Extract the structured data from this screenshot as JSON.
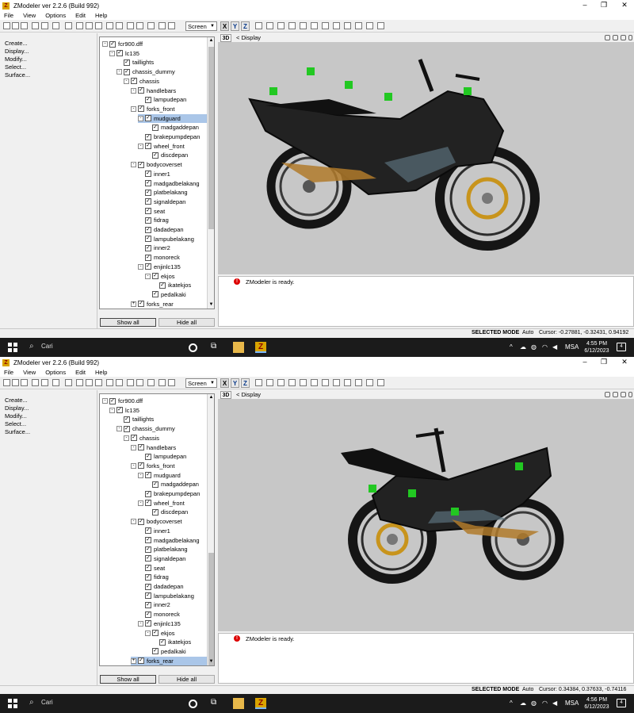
{
  "shots": [
    {
      "window_title": "ZModeler ver 2.2.6 (Build 992)",
      "menu": [
        "File",
        "View",
        "Options",
        "Edit",
        "Help"
      ],
      "toolbar": {
        "screen_label": "Screen",
        "axis_x": "X",
        "axis_y": "Y",
        "axis_z": "Z"
      },
      "left_menu": [
        "Create...",
        "Display...",
        "Modify...",
        "Select...",
        "Surface..."
      ],
      "tree": [
        {
          "label": "fcr900.dff",
          "level": 0,
          "exp": "-",
          "selected": false
        },
        {
          "label": "lc135",
          "level": 1,
          "exp": "-",
          "selected": false
        },
        {
          "label": "taillights",
          "level": 2,
          "exp": "",
          "selected": false
        },
        {
          "label": "chassis_dummy",
          "level": 2,
          "exp": "-",
          "selected": false
        },
        {
          "label": "chassis",
          "level": 3,
          "exp": "-",
          "selected": false
        },
        {
          "label": "handlebars",
          "level": 4,
          "exp": "-",
          "selected": false
        },
        {
          "label": "lampudepan",
          "level": 5,
          "exp": "",
          "selected": false
        },
        {
          "label": "forks_front",
          "level": 4,
          "exp": "-",
          "selected": false
        },
        {
          "label": "mudguard",
          "level": 5,
          "exp": "-",
          "selected": true
        },
        {
          "label": "madgaddepan",
          "level": 6,
          "exp": "",
          "selected": false
        },
        {
          "label": "brakepumpdepan",
          "level": 5,
          "exp": "",
          "selected": false
        },
        {
          "label": "wheel_front",
          "level": 5,
          "exp": "-",
          "selected": false
        },
        {
          "label": "discdepan",
          "level": 6,
          "exp": "",
          "selected": false
        },
        {
          "label": "bodycoverset",
          "level": 4,
          "exp": "-",
          "selected": false
        },
        {
          "label": "inner1",
          "level": 5,
          "exp": "",
          "selected": false
        },
        {
          "label": "madgadbelakang",
          "level": 5,
          "exp": "",
          "selected": false
        },
        {
          "label": "platbelakang",
          "level": 5,
          "exp": "",
          "selected": false
        },
        {
          "label": "signaldepan",
          "level": 5,
          "exp": "",
          "selected": false
        },
        {
          "label": "seat",
          "level": 5,
          "exp": "",
          "selected": false
        },
        {
          "label": "fidrag",
          "level": 5,
          "exp": "",
          "selected": false
        },
        {
          "label": "dadadepan",
          "level": 5,
          "exp": "",
          "selected": false
        },
        {
          "label": "lampubelakang",
          "level": 5,
          "exp": "",
          "selected": false
        },
        {
          "label": "inner2",
          "level": 5,
          "exp": "",
          "selected": false
        },
        {
          "label": "monoreck",
          "level": 5,
          "exp": "",
          "selected": false
        },
        {
          "label": "enjinlc135",
          "level": 5,
          "exp": "-",
          "selected": false
        },
        {
          "label": "ekjos",
          "level": 6,
          "exp": "-",
          "selected": false
        },
        {
          "label": "ikatekjos",
          "level": 7,
          "exp": "",
          "selected": false
        },
        {
          "label": "pedalkaki",
          "level": 6,
          "exp": "",
          "selected": false
        },
        {
          "label": "forks_rear",
          "level": 4,
          "exp": "+",
          "selected": false
        }
      ],
      "show_all": "Show all",
      "hide_all": "Hide all",
      "view_3d": "3D",
      "view_title": "Display",
      "log_message": "ZModeler is ready.",
      "status_mode": "SELECTED MODE",
      "status_auto": "Auto",
      "status_cursor": "Cursor: -0.27881, -0.32431, 0.94192",
      "search_label": "Cari",
      "lang": "MSA",
      "time": "4:55 PM",
      "date": "6/12/2023",
      "notif_count": "4"
    },
    {
      "window_title": "ZModeler ver 2.2.6 (Build 992)",
      "menu": [
        "File",
        "View",
        "Options",
        "Edit",
        "Help"
      ],
      "toolbar": {
        "screen_label": "Screen",
        "axis_x": "X",
        "axis_y": "Y",
        "axis_z": "Z"
      },
      "left_menu": [
        "Create...",
        "Display...",
        "Modify...",
        "Select...",
        "Surface..."
      ],
      "tree": [
        {
          "label": "fcr900.dff",
          "level": 0,
          "exp": "-",
          "selected": false
        },
        {
          "label": "lc135",
          "level": 1,
          "exp": "-",
          "selected": false
        },
        {
          "label": "taillights",
          "level": 2,
          "exp": "",
          "selected": false
        },
        {
          "label": "chassis_dummy",
          "level": 2,
          "exp": "-",
          "selected": false
        },
        {
          "label": "chassis",
          "level": 3,
          "exp": "-",
          "selected": false
        },
        {
          "label": "handlebars",
          "level": 4,
          "exp": "-",
          "selected": false
        },
        {
          "label": "lampudepan",
          "level": 5,
          "exp": "",
          "selected": false
        },
        {
          "label": "forks_front",
          "level": 4,
          "exp": "-",
          "selected": false
        },
        {
          "label": "mudguard",
          "level": 5,
          "exp": "-",
          "selected": false
        },
        {
          "label": "madgaddepan",
          "level": 6,
          "exp": "",
          "selected": false
        },
        {
          "label": "brakepumpdepan",
          "level": 5,
          "exp": "",
          "selected": false
        },
        {
          "label": "wheel_front",
          "level": 5,
          "exp": "-",
          "selected": false
        },
        {
          "label": "discdepan",
          "level": 6,
          "exp": "",
          "selected": false
        },
        {
          "label": "bodycoverset",
          "level": 4,
          "exp": "-",
          "selected": false
        },
        {
          "label": "inner1",
          "level": 5,
          "exp": "",
          "selected": false
        },
        {
          "label": "madgadbelakang",
          "level": 5,
          "exp": "",
          "selected": false
        },
        {
          "label": "platbelakang",
          "level": 5,
          "exp": "",
          "selected": false
        },
        {
          "label": "signaldepan",
          "level": 5,
          "exp": "",
          "selected": false
        },
        {
          "label": "seat",
          "level": 5,
          "exp": "",
          "selected": false
        },
        {
          "label": "fidrag",
          "level": 5,
          "exp": "",
          "selected": false
        },
        {
          "label": "dadadepan",
          "level": 5,
          "exp": "",
          "selected": false
        },
        {
          "label": "lampubelakang",
          "level": 5,
          "exp": "",
          "selected": false
        },
        {
          "label": "inner2",
          "level": 5,
          "exp": "",
          "selected": false
        },
        {
          "label": "monoreck",
          "level": 5,
          "exp": "",
          "selected": false
        },
        {
          "label": "enjinlc135",
          "level": 5,
          "exp": "-",
          "selected": false
        },
        {
          "label": "ekjos",
          "level": 6,
          "exp": "-",
          "selected": false
        },
        {
          "label": "ikatekjos",
          "level": 7,
          "exp": "",
          "selected": false
        },
        {
          "label": "pedalkaki",
          "level": 6,
          "exp": "",
          "selected": false
        },
        {
          "label": "forks_rear",
          "level": 4,
          "exp": "+",
          "selected": true
        }
      ],
      "show_all": "Show all",
      "hide_all": "Hide all",
      "view_3d": "3D",
      "view_title": "Display",
      "log_message": "ZModeler is ready.",
      "status_mode": "SELECTED MODE",
      "status_auto": "Auto",
      "status_cursor": "Cursor: 0.34384, 0.37633, -0.74116",
      "search_label": "Cari",
      "lang": "MSA",
      "time": "4:56 PM",
      "date": "6/12/2023",
      "notif_count": "4"
    }
  ],
  "colors": {
    "viewport_bg": "#c7c7c7",
    "selection": "#aac6e8",
    "taskbar": "#1b1b1b",
    "dummy_cube": "#22c822"
  }
}
